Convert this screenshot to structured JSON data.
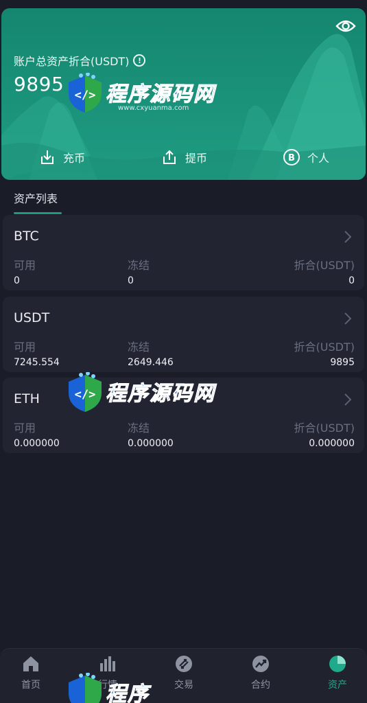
{
  "header": {
    "title": "账户总资产折合(USDT)",
    "total": "9895",
    "icons": {
      "visibility": "eye-icon",
      "info": "info-icon"
    },
    "actions": [
      {
        "label": "充币",
        "icon": "deposit-icon"
      },
      {
        "label": "提币",
        "icon": "withdraw-icon"
      },
      {
        "label": "个人",
        "icon": "bitcoin-icon"
      }
    ]
  },
  "tabs": {
    "asset_list": "资产列表"
  },
  "assets": [
    {
      "name": "BTC",
      "available_label": "可用",
      "frozen_label": "冻结",
      "value_label": "折合(USDT)",
      "available": "0",
      "frozen": "0",
      "value": "0"
    },
    {
      "name": "USDT",
      "available_label": "可用",
      "frozen_label": "冻结",
      "value_label": "折合(USDT)",
      "available": "7245.554",
      "frozen": "2649.446",
      "value": "9895"
    },
    {
      "name": "ETH",
      "available_label": "可用",
      "frozen_label": "冻结",
      "value_label": "折合(USDT)",
      "available": "0.000000",
      "frozen": "0.000000",
      "value": "0.000000"
    }
  ],
  "nav": [
    {
      "label": "首页",
      "icon": "home-icon"
    },
    {
      "label": "行情",
      "icon": "chart-bars-icon"
    },
    {
      "label": "交易",
      "icon": "exchange-icon"
    },
    {
      "label": "合约",
      "icon": "trend-icon"
    },
    {
      "label": "资产",
      "icon": "pie-icon",
      "active": true
    }
  ],
  "watermark": {
    "name_part1": "程序",
    "name_part2": "源码网",
    "url": "www.cxyuanma.com"
  },
  "colors": {
    "accent": "#1faa8b",
    "background": "#1a1c28",
    "card": "#222431",
    "hero": "#1f9c83"
  }
}
